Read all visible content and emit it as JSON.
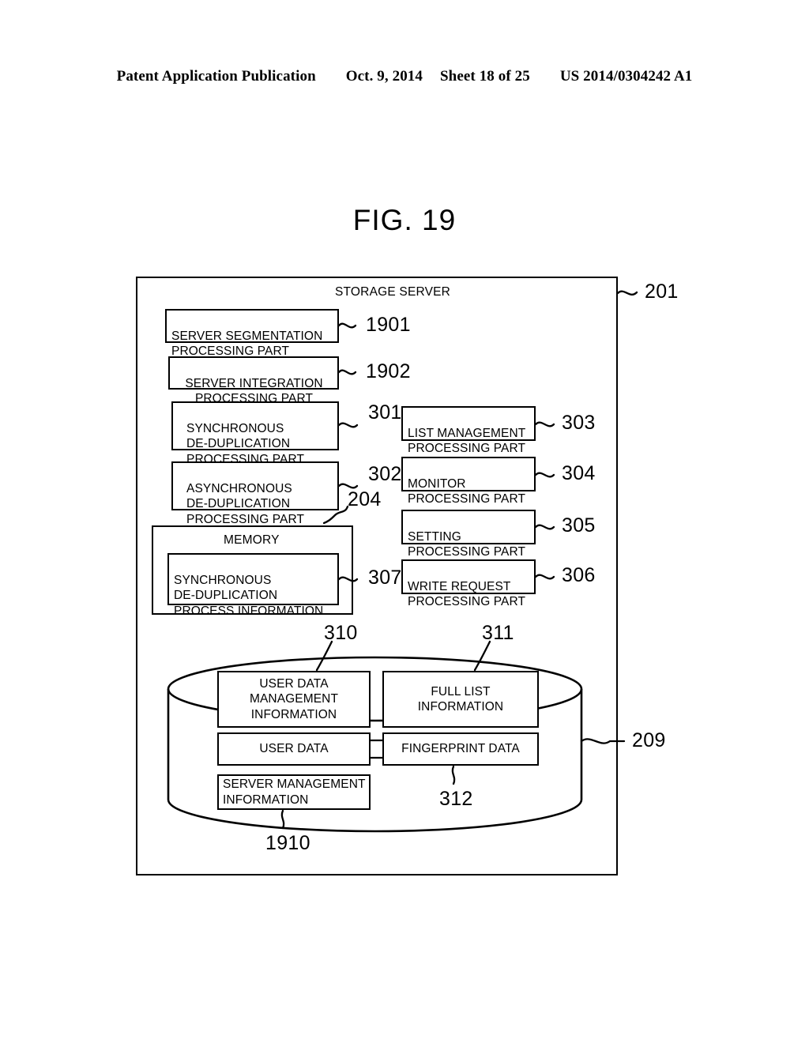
{
  "header": {
    "publication": "Patent Application Publication",
    "date": "Oct. 9, 2014",
    "sheet": "Sheet 18 of 25",
    "docnum": "US 2014/0304242 A1"
  },
  "figure": {
    "title": "FIG. 19",
    "enclosure_label": "STORAGE SERVER",
    "enclosure_ref": "201"
  },
  "left_column": [
    {
      "label": "SERVER SEGMENTATION\nPROCESSING PART",
      "ref": "1901"
    },
    {
      "label": "SERVER INTEGRATION\nPROCESSING PART",
      "ref": "1902"
    },
    {
      "label": "SYNCHRONOUS\nDE-DUPLICATION\nPROCESSING PART",
      "ref": "301"
    },
    {
      "label": "ASYNCHRONOUS\nDE-DUPLICATION\nPROCESSING PART",
      "ref": "302"
    }
  ],
  "right_column": [
    {
      "label": "LIST MANAGEMENT\nPROCESSING PART",
      "ref": "303"
    },
    {
      "label": "MONITOR\nPROCESSING PART",
      "ref": "304"
    },
    {
      "label": "SETTING\nPROCESSING PART",
      "ref": "305"
    },
    {
      "label": "WRITE REQUEST\nPROCESSING PART",
      "ref": "306"
    }
  ],
  "memory": {
    "label": "MEMORY",
    "ref": "204",
    "inner_label": "SYNCHRONOUS\nDE-DUPLICATION\nPROCESS INFORMATION",
    "inner_ref": "307"
  },
  "storage": {
    "ref": "209",
    "boxes": [
      {
        "label": "USER DATA\nMANAGEMENT\nINFORMATION",
        "ref": "310"
      },
      {
        "label": "FULL LIST\nINFORMATION",
        "ref": "311"
      },
      {
        "label": "USER DATA",
        "ref": ""
      },
      {
        "label": "FINGERPRINT DATA",
        "ref": "312"
      },
      {
        "label": "SERVER MANAGEMENT\nINFORMATION",
        "ref": "1910"
      }
    ]
  },
  "colors": {
    "ink": "#000000",
    "paper": "#ffffff"
  }
}
